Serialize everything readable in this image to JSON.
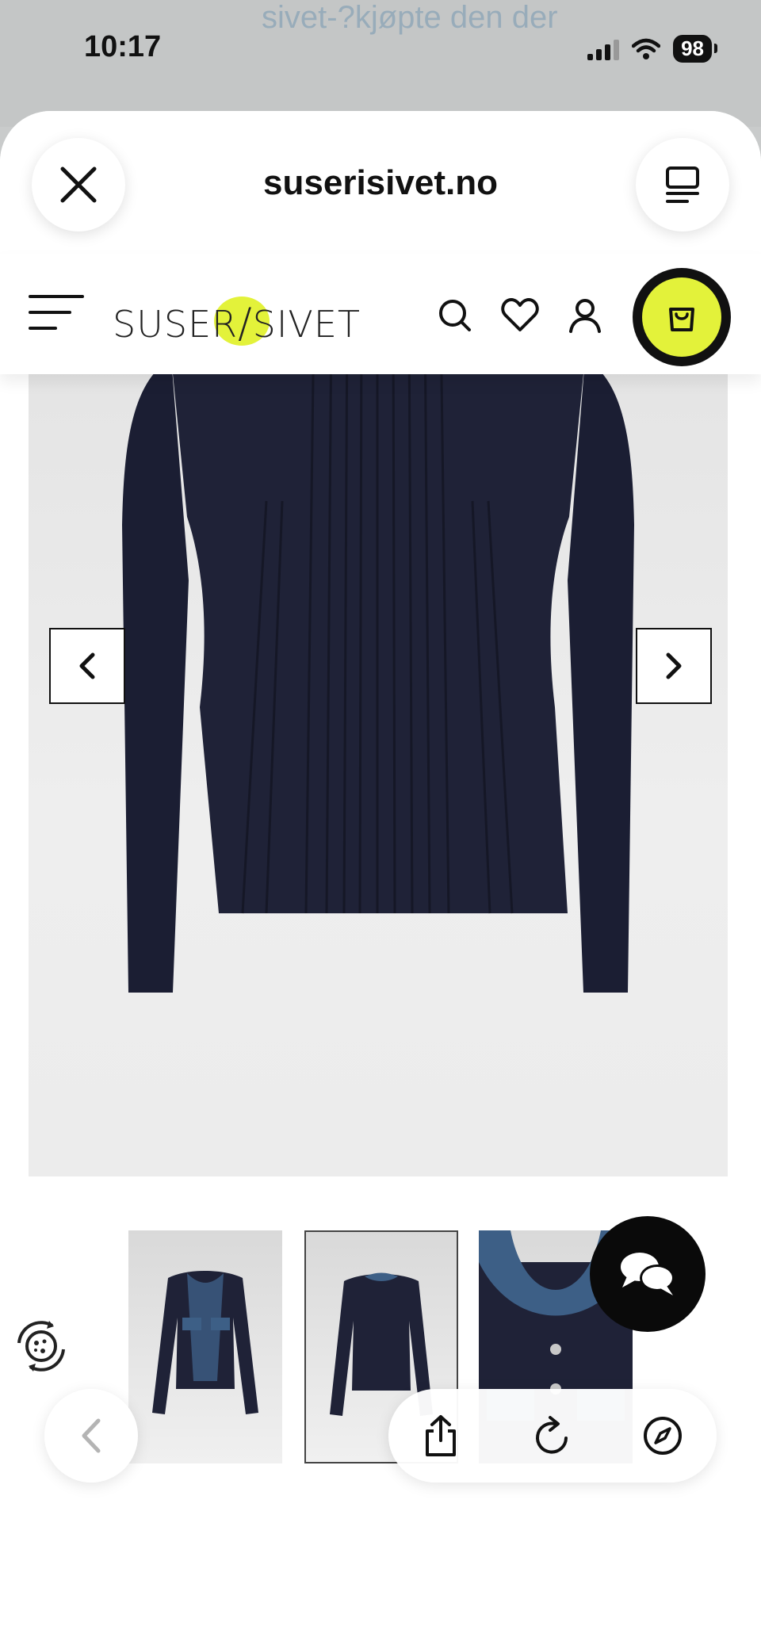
{
  "status_bar": {
    "time": "10:17",
    "battery": "98"
  },
  "background_page": {
    "text": "sivet-?kjøpte den der"
  },
  "browser": {
    "url": "suserisivet.no"
  },
  "site": {
    "logo_text_left": "SUSER",
    "logo_text_right": "SIVET",
    "brand_color": "#e3f23a"
  },
  "icons": {
    "close": "close-icon",
    "tabs": "tabs-icon",
    "menu": "hamburger-icon",
    "search": "search-icon",
    "wishlist": "heart-icon",
    "account": "user-icon",
    "cart": "shopping-bag-icon",
    "prev": "chevron-left-icon",
    "next": "chevron-right-icon",
    "chat": "chat-bubbles-icon",
    "cookie": "cookie-settings-icon",
    "share": "share-icon",
    "reload": "reload-icon",
    "compass": "compass-icon"
  },
  "gallery": {
    "thumbnail_count": 3,
    "active_thumbnail": 2
  }
}
